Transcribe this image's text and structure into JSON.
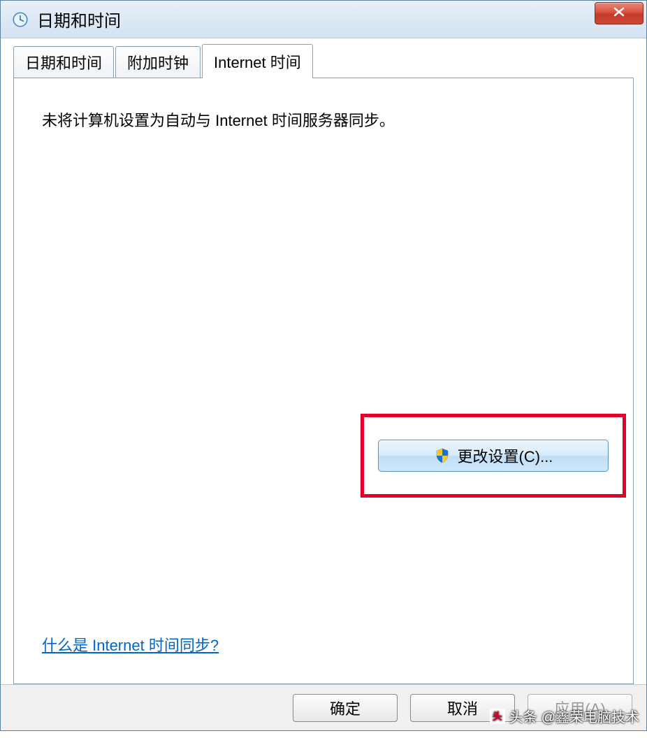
{
  "titlebar": {
    "title": "日期和时间"
  },
  "tabs": {
    "items": [
      {
        "label": "日期和时间",
        "active": false
      },
      {
        "label": "附加时钟",
        "active": false
      },
      {
        "label": "Internet 时间",
        "active": true
      }
    ]
  },
  "panel": {
    "status_text": "未将计算机设置为自动与 Internet 时间服务器同步。",
    "change_settings_label": "更改设置(C)...",
    "help_link": "什么是 Internet 时间同步?"
  },
  "buttons": {
    "ok": "确定",
    "cancel": "取消",
    "apply": "应用(A)"
  },
  "watermark": {
    "prefix": "头条",
    "text": "@鑫荣电脑技术"
  }
}
